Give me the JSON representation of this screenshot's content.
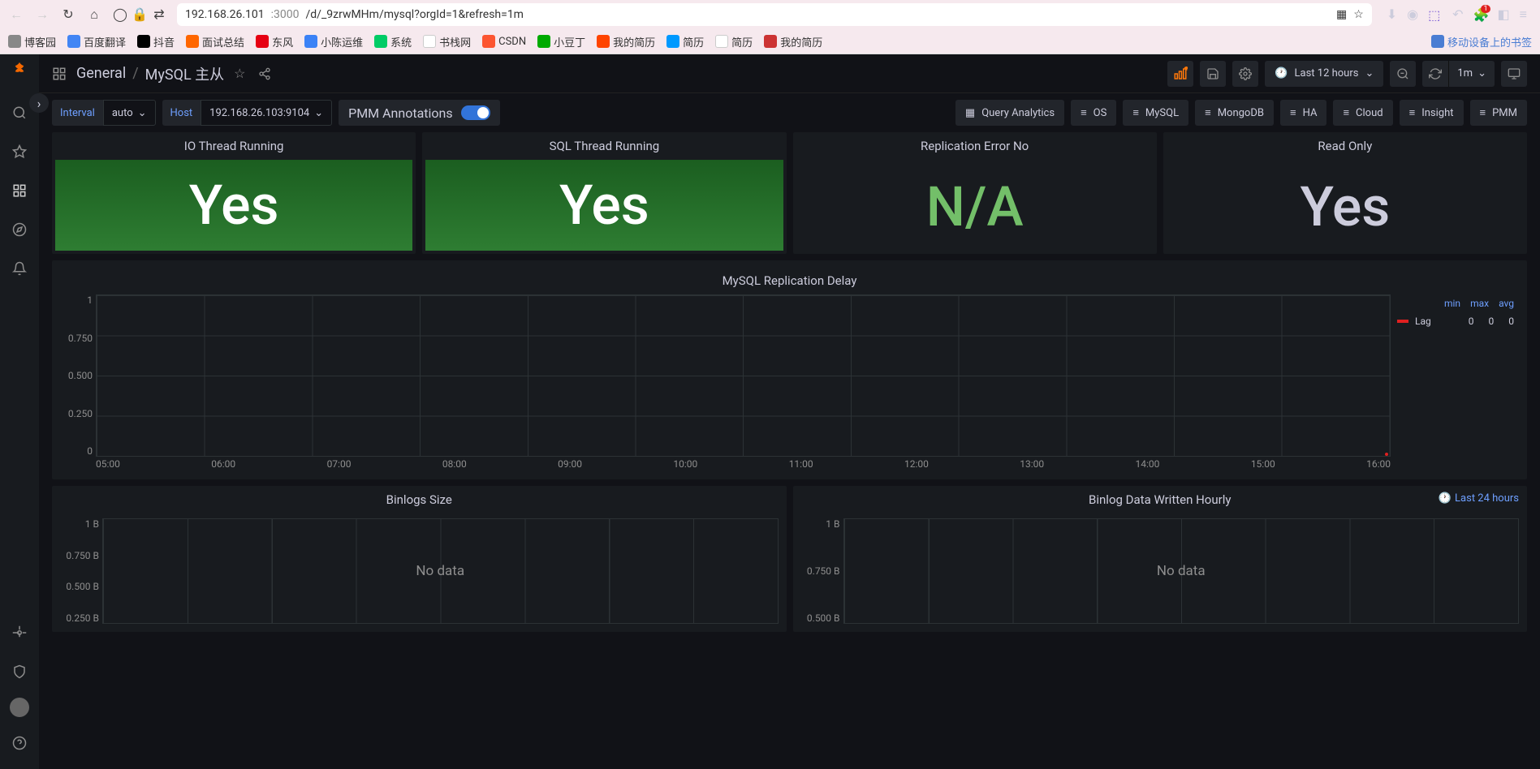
{
  "browser": {
    "url_host": "192.168.26.101",
    "url_port": ":3000",
    "url_path": "/d/_9zrwMHm/mysql?orgId=1&refresh=1m",
    "bookmarks": [
      "博客园",
      "百度翻译",
      "抖音",
      "面试总结",
      "东风",
      "小陈运维",
      "系统",
      "书栈网",
      "CSDN",
      "小豆丁",
      "我的简历",
      "简历",
      "简历",
      "我的简历"
    ],
    "bookmark_right": "移动设备上的书签",
    "ext_badge": "1"
  },
  "header": {
    "folder": "General",
    "page": "MySQL 主从",
    "time_label": "Last 12 hours",
    "refresh_rate": "1m"
  },
  "vars": {
    "interval_label": "Interval",
    "interval_value": "auto",
    "host_label": "Host",
    "host_value": "192.168.26.103:9104",
    "pmm_label": "PMM Annotations"
  },
  "links": [
    "Query Analytics",
    "OS",
    "MySQL",
    "MongoDB",
    "HA",
    "Cloud",
    "Insight",
    "PMM"
  ],
  "stats": [
    {
      "title": "IO Thread Running",
      "value": "Yes",
      "style": "green"
    },
    {
      "title": "SQL Thread Running",
      "value": "Yes",
      "style": "green"
    },
    {
      "title": "Replication Error No",
      "value": "N/A",
      "style": "na"
    },
    {
      "title": "Read Only",
      "value": "Yes",
      "style": "grey"
    }
  ],
  "chart_data": {
    "type": "line",
    "title": "MySQL Replication Delay",
    "categories": [
      "05:00",
      "06:00",
      "07:00",
      "08:00",
      "09:00",
      "10:00",
      "11:00",
      "12:00",
      "13:00",
      "14:00",
      "15:00",
      "16:00"
    ],
    "ylim": [
      0,
      1
    ],
    "yticks": [
      "1",
      "0.750",
      "0.500",
      "0.250",
      "0"
    ],
    "series": [
      {
        "name": "Lag",
        "values": [
          0,
          0,
          0,
          0,
          0,
          0,
          0,
          0,
          0,
          0,
          0,
          0
        ],
        "color": "#e02020"
      }
    ],
    "legend_cols": [
      "min",
      "max",
      "avg"
    ],
    "legend_vals": [
      "0",
      "0",
      "0"
    ]
  },
  "panels": {
    "binlogs": {
      "title": "Binlogs Size",
      "yticks": [
        "1 B",
        "0.750 B",
        "0.500 B",
        "0.250 B"
      ],
      "nodata": "No data"
    },
    "binlog_hourly": {
      "title": "Binlog Data Written Hourly",
      "yticks": [
        "1 B",
        "0.750 B",
        "0.500 B"
      ],
      "nodata": "No data",
      "corner": "Last 24 hours"
    }
  }
}
